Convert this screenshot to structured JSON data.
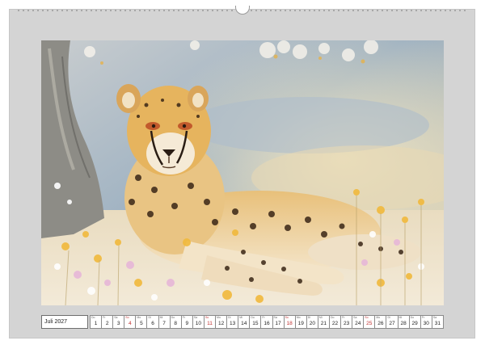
{
  "calendar": {
    "month_label": "Juli 2027",
    "days": [
      {
        "num": "1",
        "dow": "Do",
        "sunday": false
      },
      {
        "num": "2",
        "dow": "Fr",
        "sunday": false
      },
      {
        "num": "3",
        "dow": "Sa",
        "sunday": false
      },
      {
        "num": "4",
        "dow": "So",
        "sunday": true
      },
      {
        "num": "5",
        "dow": "Mo",
        "sunday": false
      },
      {
        "num": "6",
        "dow": "Di",
        "sunday": false
      },
      {
        "num": "7",
        "dow": "Mi",
        "sunday": false
      },
      {
        "num": "8",
        "dow": "Do",
        "sunday": false
      },
      {
        "num": "9",
        "dow": "Fr",
        "sunday": false
      },
      {
        "num": "10",
        "dow": "Sa",
        "sunday": false
      },
      {
        "num": "11",
        "dow": "So",
        "sunday": true
      },
      {
        "num": "12",
        "dow": "Mo",
        "sunday": false
      },
      {
        "num": "13",
        "dow": "Di",
        "sunday": false
      },
      {
        "num": "14",
        "dow": "Mi",
        "sunday": false
      },
      {
        "num": "15",
        "dow": "Do",
        "sunday": false
      },
      {
        "num": "16",
        "dow": "Fr",
        "sunday": false
      },
      {
        "num": "17",
        "dow": "Sa",
        "sunday": false
      },
      {
        "num": "18",
        "dow": "So",
        "sunday": true
      },
      {
        "num": "19",
        "dow": "Mo",
        "sunday": false
      },
      {
        "num": "20",
        "dow": "Di",
        "sunday": false
      },
      {
        "num": "21",
        "dow": "Mi",
        "sunday": false
      },
      {
        "num": "22",
        "dow": "Do",
        "sunday": false
      },
      {
        "num": "23",
        "dow": "Fr",
        "sunday": false
      },
      {
        "num": "24",
        "dow": "Sa",
        "sunday": false
      },
      {
        "num": "25",
        "dow": "So",
        "sunday": true
      },
      {
        "num": "26",
        "dow": "Mo",
        "sunday": false
      },
      {
        "num": "27",
        "dow": "Di",
        "sunday": false
      },
      {
        "num": "28",
        "dow": "Mi",
        "sunday": false
      },
      {
        "num": "29",
        "dow": "Do",
        "sunday": false
      },
      {
        "num": "30",
        "dow": "Fr",
        "sunday": false
      },
      {
        "num": "31",
        "dow": "Sa",
        "sunday": false
      }
    ]
  },
  "colors": {
    "page": "#d4d4d4",
    "sunday": "#c03030"
  }
}
